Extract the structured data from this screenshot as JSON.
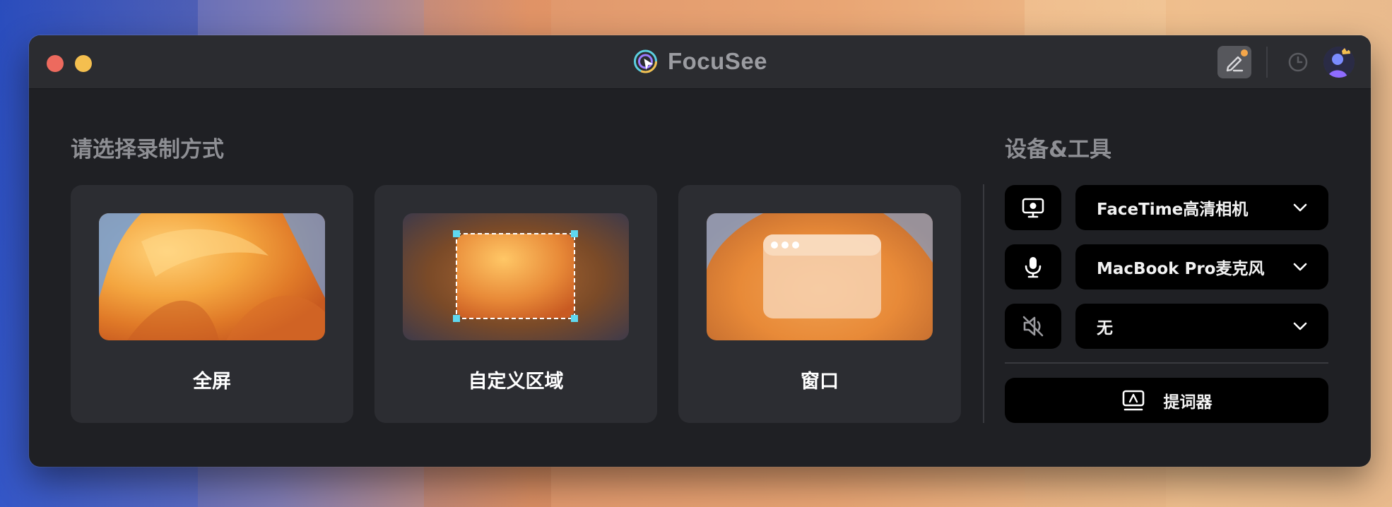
{
  "window": {
    "app_name": "FocuSee",
    "accent_color": "#f4a64a"
  },
  "titlebar": {
    "close_icon": "close-dot",
    "minimize_icon": "minimize-dot",
    "edit_icon": "pen-edit-icon",
    "history_icon": "clock-icon",
    "avatar_icon": "user-avatar-crown"
  },
  "record_mode": {
    "title": "请选择录制方式",
    "modes": [
      {
        "label": "全屏",
        "icon": "fullscreen-thumbnail"
      },
      {
        "label": "自定义区域",
        "icon": "custom-area-thumbnail"
      },
      {
        "label": "窗口",
        "icon": "window-thumbnail"
      }
    ]
  },
  "devices": {
    "title": "设备&工具",
    "camera": {
      "icon": "camera-monitor-icon",
      "value": "FaceTime高清相机"
    },
    "microphone": {
      "icon": "microphone-icon",
      "value": "MacBook Pro麦克风"
    },
    "audio": {
      "icon": "speaker-muted-icon",
      "value": "无"
    },
    "teleprompter": {
      "icon": "teleprompter-icon",
      "label": "提词器"
    }
  }
}
